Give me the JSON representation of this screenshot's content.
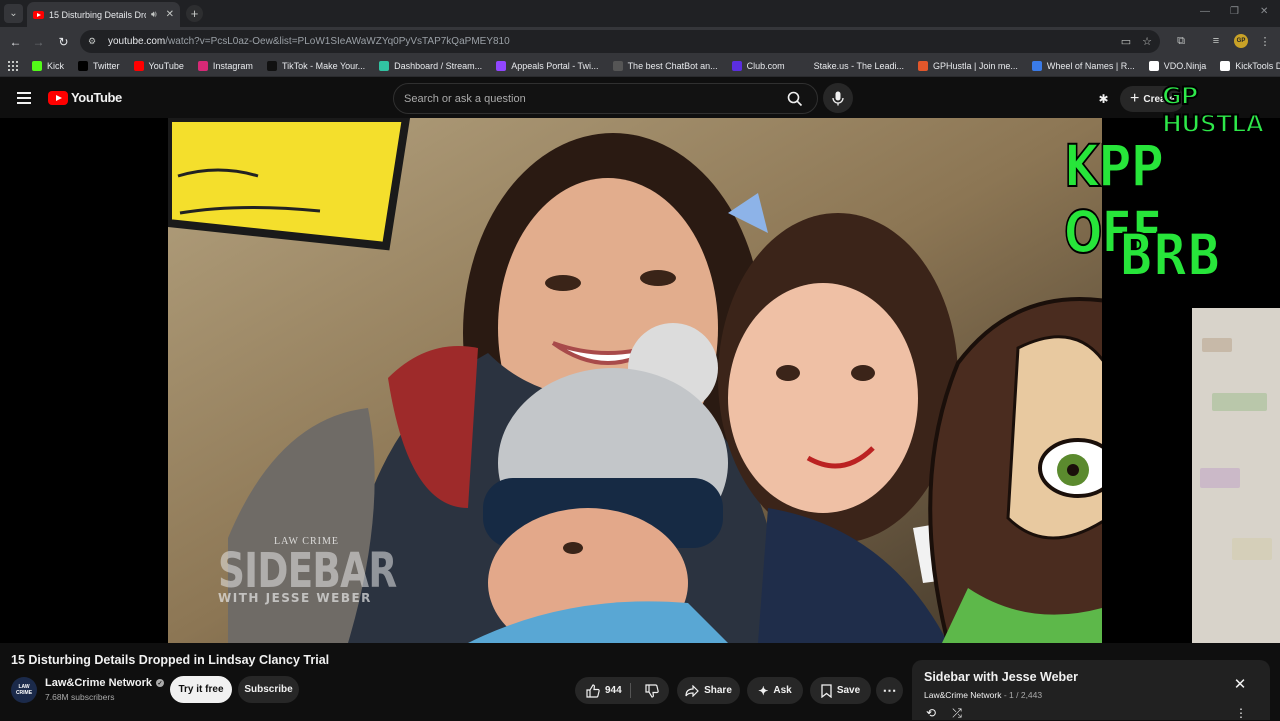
{
  "browser": {
    "tab_title": "15 Disturbing Details Dropp",
    "url_host": "youtube.com",
    "url_path": "/watch?v=PcsL0az-Oew&list=PLoW1SIeAWaWZYq0PyVsTAP7kQaPMEY810"
  },
  "bookmarks": [
    {
      "label": "Kick",
      "icon": "kick-icon",
      "color": "#53fc18"
    },
    {
      "label": "Twitter",
      "icon": "x-icon",
      "color": "#000000"
    },
    {
      "label": "YouTube",
      "icon": "youtube-icon",
      "color": "#ff0000"
    },
    {
      "label": "Instagram",
      "icon": "instagram-icon",
      "color": "#d62976"
    },
    {
      "label": "TikTok - Make Your...",
      "icon": "tiktok-icon",
      "color": "#111111"
    },
    {
      "label": "Dashboard / Stream...",
      "icon": "streamlabs-icon",
      "color": "#31c3a2"
    },
    {
      "label": "Appeals Portal - Twi...",
      "icon": "twitch-icon",
      "color": "#9146ff"
    },
    {
      "label": "The best ChatBot an...",
      "icon": "chatbot-icon",
      "color": "#555555"
    },
    {
      "label": "Club.com",
      "icon": "club-icon",
      "color": "#5b2ee0"
    },
    {
      "label": "Stake.us - The Leadi...",
      "icon": "stake-icon",
      "color": "#35363a"
    },
    {
      "label": "GPHustla | Join me...",
      "icon": "gphustla-icon",
      "color": "#e2572b"
    },
    {
      "label": "Wheel of Names | R...",
      "icon": "wheel-icon",
      "color": "#3a7be8"
    },
    {
      "label": "VDO.Ninja",
      "icon": "vdoninja-icon",
      "color": "#ffffff"
    },
    {
      "label": "KickTools Dashboard",
      "icon": "kicktools-icon",
      "color": "#ffffff"
    }
  ],
  "youtube": {
    "logo_text": "YouTube",
    "search_placeholder": "Search or ask a question",
    "create_label": "Create"
  },
  "overlay": {
    "brand": "GP HUSTLA",
    "line1": "KPP OFF",
    "line2": "BRB"
  },
  "watermark": {
    "top": "LAW CRIME",
    "main": "SIDEBAR",
    "sub": "WITH JESSE WEBER"
  },
  "video": {
    "title": "15 Disturbing Details Dropped in Lindsay Clancy Trial",
    "channel": "Law&Crime Network",
    "channel_avatar_text": "LAW CRIME",
    "subscribers": "7.68M subscribers",
    "try_free": "Try it free",
    "subscribe": "Subscribe",
    "likes": "944",
    "share": "Share",
    "ask": "Ask",
    "save": "Save"
  },
  "playlist": {
    "title": "Sidebar with Jesse Weber",
    "channel": "Law&Crime Network",
    "position": "1 / 2,443"
  },
  "colors": {
    "accent_red": "#ff0000",
    "overlay_green": "#27e53a",
    "background": "#0f0f0f"
  }
}
